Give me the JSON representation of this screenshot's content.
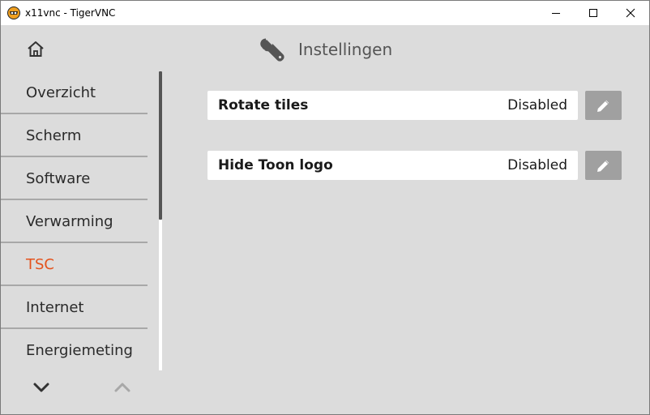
{
  "window": {
    "title": "x11vnc - TigerVNC",
    "app_icon": "tigervnc-icon",
    "controls": [
      "minimize-icon",
      "maximize-icon",
      "close-icon"
    ]
  },
  "header": {
    "home_icon": "home-icon",
    "title_icon": "wrench-icon",
    "title": "Instellingen"
  },
  "sidebar": {
    "items": [
      {
        "label": "Overzicht",
        "active": false
      },
      {
        "label": "Scherm",
        "active": false
      },
      {
        "label": "Software",
        "active": false
      },
      {
        "label": "Verwarming",
        "active": false
      },
      {
        "label": "TSC",
        "active": true
      },
      {
        "label": "Internet",
        "active": false
      },
      {
        "label": "Energiemeting",
        "active": false
      }
    ],
    "scroll_down_icon": "chevron-down-icon",
    "scroll_up_icon": "chevron-up-icon"
  },
  "settings": [
    {
      "name": "Rotate tiles",
      "value": "Disabled",
      "edit_icon": "pencil-icon"
    },
    {
      "name": "Hide Toon logo",
      "value": "Disabled",
      "edit_icon": "pencil-icon"
    }
  ],
  "colors": {
    "background": "#dcdcdc",
    "active_item": "#e4521c",
    "edit_button": "#a0a0a0",
    "row_background": "#ffffff"
  }
}
